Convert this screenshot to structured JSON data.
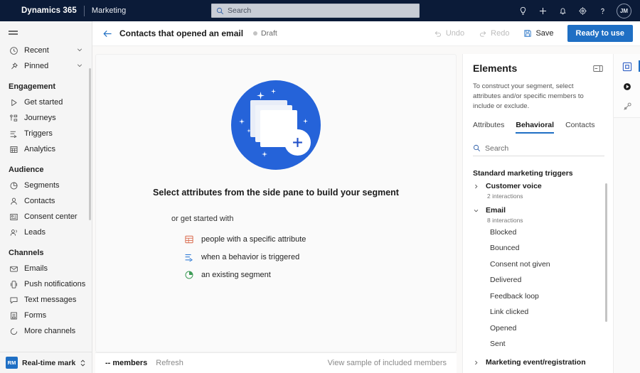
{
  "topbar": {
    "brand": "Dynamics 365",
    "app_name": "Marketing",
    "search_placeholder": "Search",
    "icons": [
      {
        "name": "lightbulb-icon",
        "label": "Tips"
      },
      {
        "name": "plus-icon",
        "label": "New"
      },
      {
        "name": "bell-icon",
        "label": "Notifications"
      },
      {
        "name": "gear-icon",
        "label": "Settings"
      },
      {
        "name": "help-icon",
        "label": "Help"
      }
    ],
    "avatar_initials": "JM"
  },
  "sidebar": {
    "quick": [
      {
        "label": "Recent",
        "icon": "clock-icon",
        "chevron": "chevron-down-icon"
      },
      {
        "label": "Pinned",
        "icon": "pin-icon",
        "chevron": "chevron-down-icon"
      }
    ],
    "groups": [
      {
        "title": "Engagement",
        "items": [
          {
            "label": "Get started",
            "icon": "play-icon"
          },
          {
            "label": "Journeys",
            "icon": "journeys-icon"
          },
          {
            "label": "Triggers",
            "icon": "trigger-icon"
          },
          {
            "label": "Analytics",
            "icon": "analytics-icon"
          }
        ]
      },
      {
        "title": "Audience",
        "items": [
          {
            "label": "Segments",
            "icon": "segments-icon"
          },
          {
            "label": "Contacts",
            "icon": "contact-icon"
          },
          {
            "label": "Consent center",
            "icon": "consent-icon"
          },
          {
            "label": "Leads",
            "icon": "leads-icon"
          }
        ]
      },
      {
        "title": "Channels",
        "items": [
          {
            "label": "Emails",
            "icon": "mail-icon"
          },
          {
            "label": "Push notifications",
            "icon": "push-icon"
          },
          {
            "label": "Text messages",
            "icon": "sms-icon"
          },
          {
            "label": "Forms",
            "icon": "forms-icon"
          },
          {
            "label": "More channels",
            "icon": "more-channels-icon"
          }
        ]
      }
    ],
    "area_switcher": {
      "badge": "RM",
      "label": "Real-time marketi..."
    }
  },
  "commandbar": {
    "back": "back-arrow",
    "title": "Contacts that opened an email",
    "status": "Draft",
    "undo_label": "Undo",
    "redo_label": "Redo",
    "save_label": "Save",
    "primary_label": "Ready to use"
  },
  "canvas": {
    "empty_title": "Select attributes from the side pane to build your segment",
    "get_started_label": "or get started with",
    "options": [
      {
        "label": "people with a specific attribute",
        "icon": "attribute-icon",
        "color": "#d9694b"
      },
      {
        "label": "when a behavior is triggered",
        "icon": "behavior-trigger-icon",
        "color": "#2f7bd6"
      },
      {
        "label": "an existing segment",
        "icon": "existing-segment-icon",
        "color": "#3f9c58"
      }
    ]
  },
  "footer": {
    "members_count": "-- members",
    "refresh_label": "Refresh",
    "view_sample_label": "View sample of included members"
  },
  "elements": {
    "title": "Elements",
    "description": "To construct your segment, select attributes and/or specific members to include or exclude.",
    "tabs": [
      {
        "label": "Attributes",
        "active": false
      },
      {
        "label": "Behavioral",
        "active": true
      },
      {
        "label": "Contacts",
        "active": false
      }
    ],
    "search_placeholder": "Search",
    "tree_title": "Standard marketing triggers",
    "groups": [
      {
        "name": "Customer voice",
        "sub": "2 interactions",
        "expanded": false,
        "leaves": []
      },
      {
        "name": "Email",
        "sub": "8 interactions",
        "expanded": true,
        "leaves": [
          "Blocked",
          "Bounced",
          "Consent not given",
          "Delivered",
          "Feedback loop",
          "Link clicked",
          "Opened",
          "Sent"
        ]
      },
      {
        "name": "Marketing event/registration",
        "sub": "",
        "expanded": false,
        "leaves": []
      }
    ]
  },
  "rail": {
    "buttons": [
      {
        "name": "elements-panel-icon",
        "active": true
      },
      {
        "name": "play-circle-icon",
        "active": false
      },
      {
        "name": "personalization-icon",
        "active": false
      }
    ]
  },
  "colors": {
    "brand_blue": "#1f6fc4",
    "topbar_navy": "#0b1b38",
    "illustration_blue": "#2563d9"
  }
}
